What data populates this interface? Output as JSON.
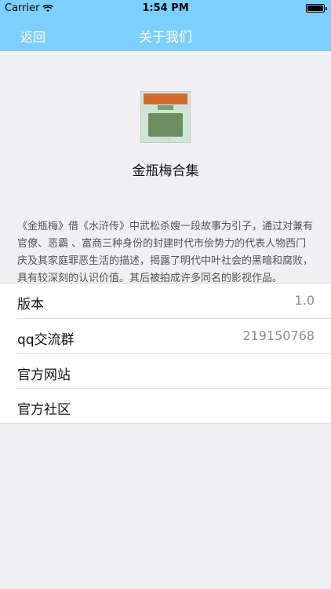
{
  "status_bar": {
    "carrier": "Carrier",
    "time": "1:54 PM",
    "battery_level": 1.0
  },
  "nav": {
    "back_label": "返回",
    "title": "关于我们"
  },
  "app": {
    "name": "金瓶梅合集",
    "description": "《金瓶梅》借《水浒传》中武松杀嫂一段故事为引子，通过对兼有官僚、恶霸 、富商三种身份的封建时代市侩势力的代表人物西门庆及其家庭罪恶生活的描述，揭露了明代中叶社会的黑暗和腐败，具有较深刻的认识价值。其后被拍成许多同名的影视作品。"
  },
  "list": {
    "items": [
      {
        "label": "版本",
        "value": "1.0"
      },
      {
        "label": "qq交流群",
        "value": "219150768"
      },
      {
        "label": "官方网站",
        "value": ""
      },
      {
        "label": "官方社区",
        "value": ""
      }
    ]
  },
  "colors": {
    "nav_bar": "#7ccfff",
    "background": "#efeff4"
  }
}
